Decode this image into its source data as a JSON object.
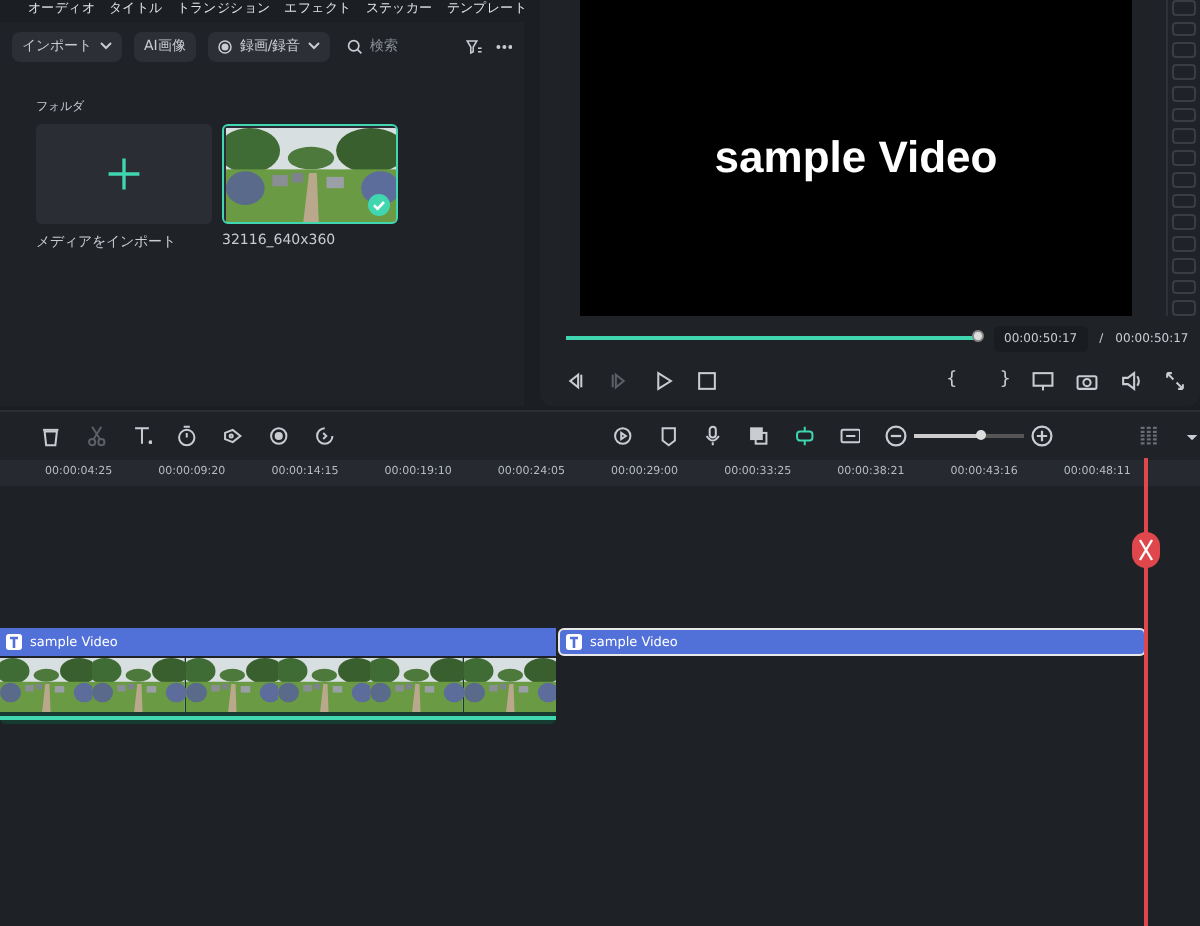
{
  "media_tabs": [
    {
      "label": "オーディオ"
    },
    {
      "label": "タイトル"
    },
    {
      "label": "トランジション"
    },
    {
      "label": "エフェクト"
    },
    {
      "label": "ステッカー"
    },
    {
      "label": "テンプレート"
    }
  ],
  "media_toolbar": {
    "import": "インポート",
    "ai_image": "AI画像",
    "record": "録画/録音",
    "search": {
      "placeholder": "検索"
    }
  },
  "folder_label": "フォルダ",
  "media_items": [
    {
      "kind": "import",
      "label": "メディアをインポート",
      "selected": false
    },
    {
      "kind": "picture",
      "label": "32116_640x360",
      "selected": true
    }
  ],
  "preview": {
    "text": "sample Video",
    "level": 0.99,
    "current_time": "00:00:50:17",
    "separator": "/",
    "total_time": "00:00:50:17",
    "brace_open": "{",
    "brace_close": "}"
  },
  "timeline": {
    "ruler": [
      "00:00:04:25",
      "00:00:09:20",
      "00:00:14:15",
      "00:00:19:10",
      "00:00:24:05",
      "00:00:29:00",
      "00:00:33:25",
      "00:00:38:21",
      "00:00:43:16",
      "00:00:48:11"
    ],
    "zoom": {
      "level": 0.6
    },
    "text_clips": [
      {
        "label": "sample Video",
        "selected": false
      },
      {
        "label": "sample Video",
        "selected": true
      }
    ]
  }
}
